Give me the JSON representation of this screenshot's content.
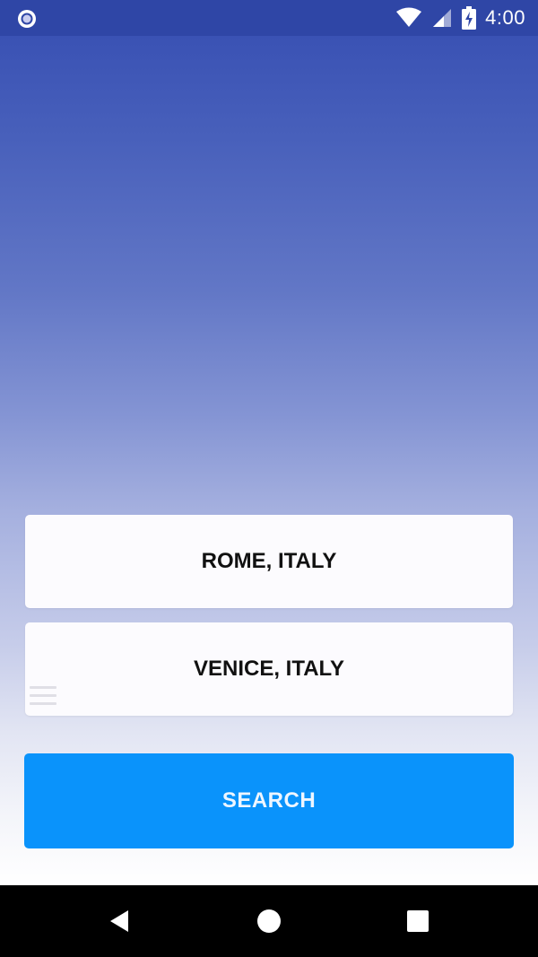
{
  "status_bar": {
    "time": "4:00",
    "icons": [
      "app-notification-icon",
      "wifi-icon",
      "signal-icon",
      "battery-charging-icon"
    ]
  },
  "colors": {
    "status_bar": "#2f46a6",
    "gradient_top": "#3a52b4",
    "gradient_bottom": "#ffffff",
    "card_background": "#fcfbfe",
    "search_button": "#0a93fb",
    "nav_bar": "#000000"
  },
  "main": {
    "origin": "ROME, ITALY",
    "destination": "VENICE, ITALY",
    "search_label": "SEARCH"
  },
  "nav_bar": {
    "buttons": [
      "back-icon",
      "home-icon",
      "recents-icon"
    ]
  }
}
